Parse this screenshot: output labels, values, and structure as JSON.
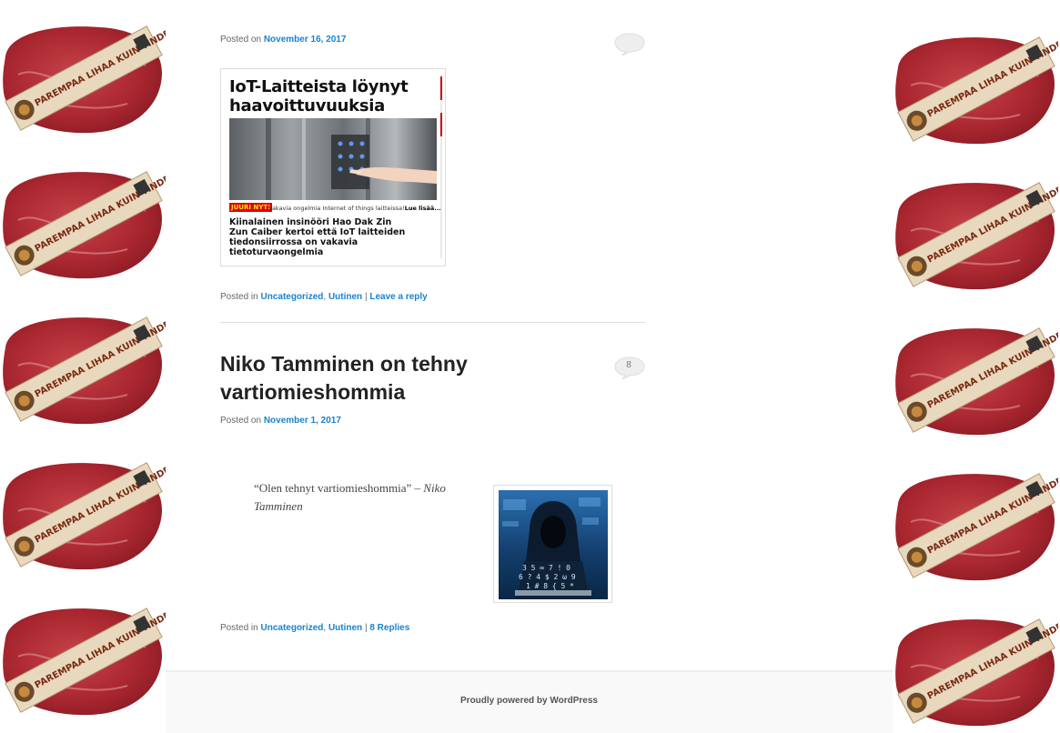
{
  "post1": {
    "posted_on_label": "Posted on",
    "date": "November 16, 2017",
    "comment_count": "",
    "image": {
      "headline": "IoT-Laitteista löynyt haavoittuvuuksia",
      "badge": "JUURI NYT!",
      "ticker": "Vakavia ongelmia Internet of things laitteissa!",
      "ticker_more": "Lue lisää...",
      "body": "Kiinalainen insinööri Hao Dak Zin Zun Caiber kertoi että IoT laitteiden tiedonsiirrossa on vakavia tietoturvaongelmia"
    },
    "posted_in_label": "Posted in",
    "categories": [
      "Uncategorized",
      "Uutinen"
    ],
    "separator": "|",
    "reply_link": "Leave a reply"
  },
  "post2": {
    "title": "Niko Tamminen on tehny vartiomieshommia",
    "comment_count": "8",
    "posted_on_label": "Posted on",
    "date": "November 1, 2017",
    "quote": "“Olen tehnyt vartiomieshommia”",
    "quote_dash": "–",
    "quote_author": "Niko Tamminen",
    "posted_in_label": "Posted in",
    "categories": [
      "Uncategorized",
      "Uutinen"
    ],
    "separator": "|",
    "replies_link": "8 Replies"
  },
  "footer": {
    "text": "Proudly powered by WordPress"
  },
  "background_ad": {
    "banner_text": "PAREMPAA LIHAA KUIN TINDERISSÄ"
  }
}
